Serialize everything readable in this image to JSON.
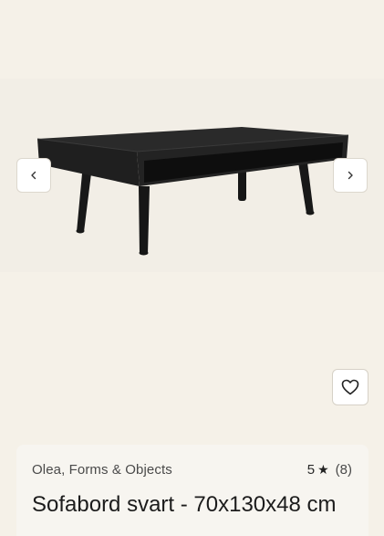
{
  "gallery": {
    "product_image_alt": "Sofabord svart",
    "prev_icon": "chevron-left-icon",
    "next_icon": "chevron-right-icon",
    "favorite_icon": "heart-icon"
  },
  "product": {
    "brand": "Olea, Forms & Objects",
    "rating_value": "5",
    "rating_star": "★",
    "rating_count": "(8)",
    "title": "Sofabord svart - 70x130x48 cm"
  },
  "colors": {
    "page_background": "#f5f1e8",
    "card_background": "#f7f5f0",
    "table_color": "#1d1d1d",
    "text_primary": "#1c1c1c",
    "text_secondary": "#4a4a4a"
  }
}
